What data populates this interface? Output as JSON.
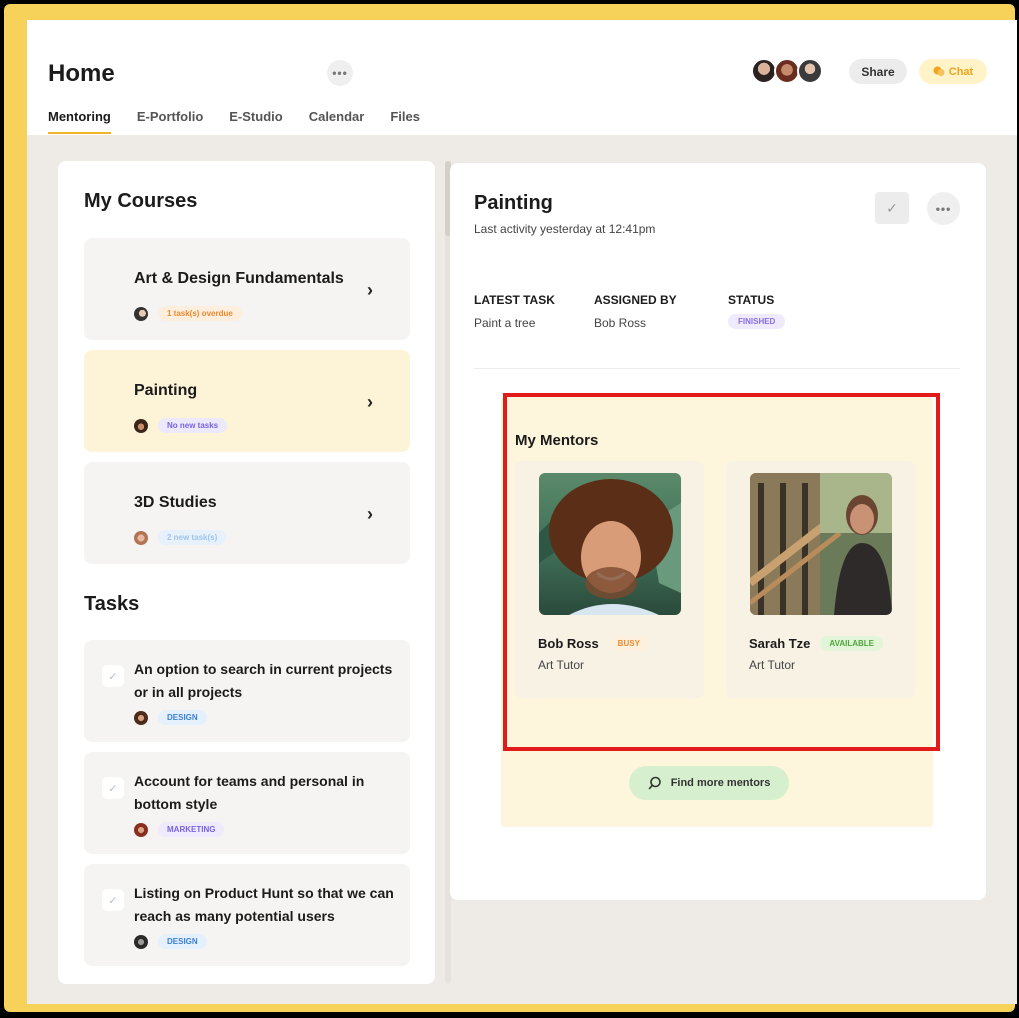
{
  "header": {
    "title": "Home",
    "tabs": [
      "Mentoring",
      "E-Portfolio",
      "E-Studio",
      "Calendar",
      "Files"
    ],
    "share_label": "Share",
    "chat_label": "Chat",
    "more_glyph": "•••"
  },
  "courses": {
    "title": "My Courses",
    "items": [
      {
        "name": "Art & Design Fundamentals",
        "badge": "1 task(s) overdue"
      },
      {
        "name": "Painting",
        "badge": "No new tasks"
      },
      {
        "name": "3D Studies",
        "badge": "2 new task(s)"
      }
    ]
  },
  "tasks": {
    "title": "Tasks",
    "items": [
      {
        "text": "An option to search in current projects or in all projects",
        "tag": "DESIGN"
      },
      {
        "text": "Account for teams and personal in bottom style",
        "tag": "MARKETING"
      },
      {
        "text": "Listing on Product Hunt so that we can reach as many potential users",
        "tag": "DESIGN"
      }
    ]
  },
  "detail": {
    "title": "Painting",
    "subtitle": "Last activity yesterday at 12:41pm",
    "latest_task_label": "LATEST TASK",
    "latest_task_value": "Paint a tree",
    "assigned_by_label": "ASSIGNED BY",
    "assigned_by_value": "Bob Ross",
    "status_label": "STATUS",
    "status_value": "FINISHED"
  },
  "mentors": {
    "title": "My Mentors",
    "items": [
      {
        "name": "Bob Ross",
        "status": "BUSY",
        "role": "Art Tutor"
      },
      {
        "name": "Sarah Tze",
        "status": "AVAILABLE",
        "role": "Art Tutor"
      }
    ],
    "find_label": "Find more mentors"
  },
  "icons": {
    "more": "ellipsis-icon",
    "chat": "chat-bubble-icon",
    "check": "check-icon",
    "chevron": "chevron-right-icon",
    "search": "search-icon"
  },
  "colors": {
    "accent": "#f0b429",
    "frame": "#f7d25a",
    "highlight": "#e21a1a"
  }
}
